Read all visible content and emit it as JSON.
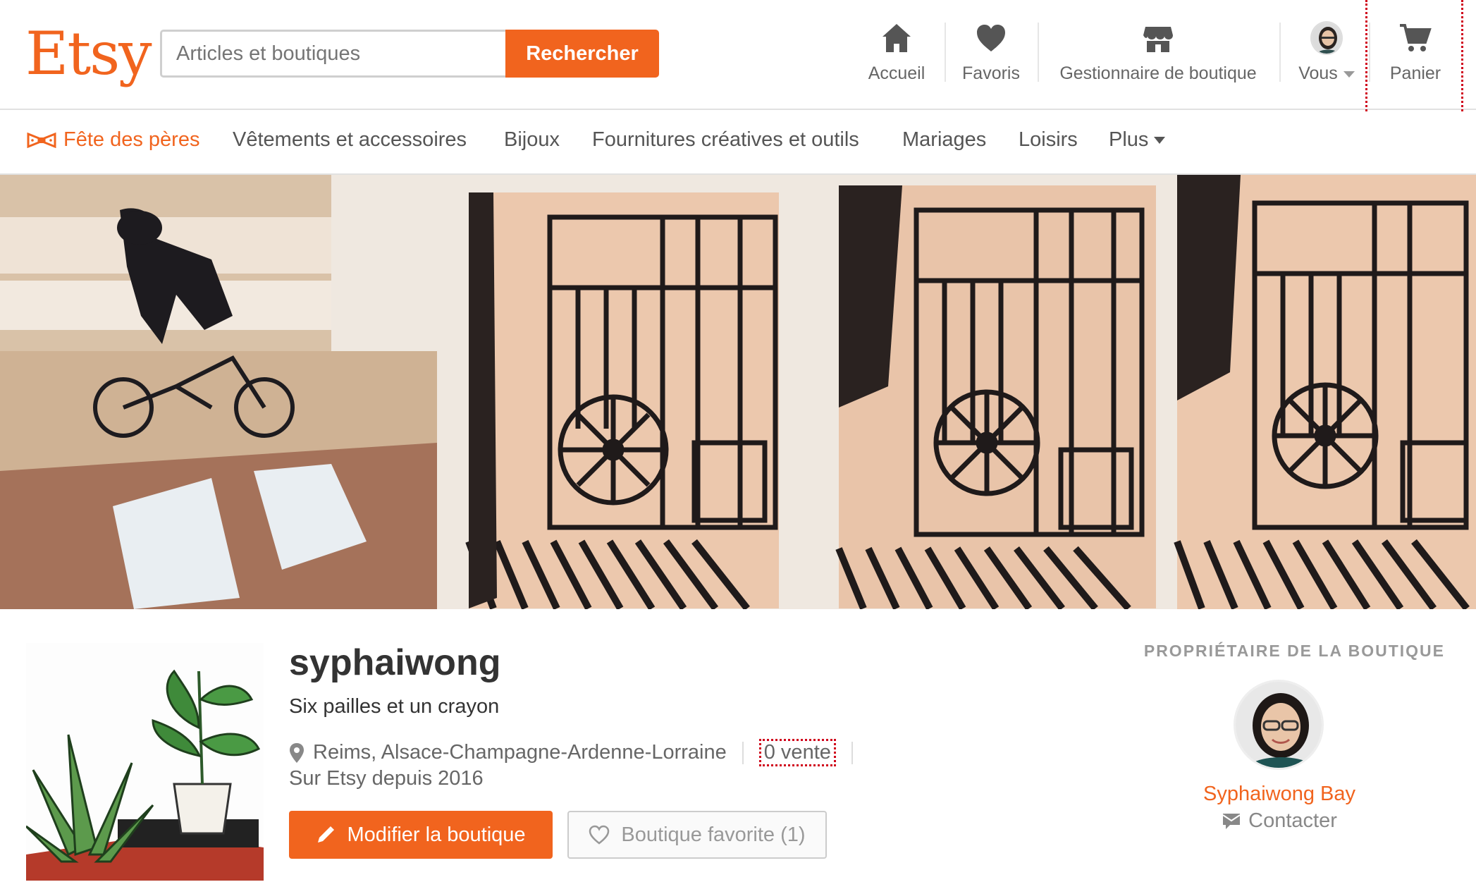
{
  "header": {
    "logo": "Etsy",
    "search": {
      "placeholder": "Articles et boutiques",
      "value": ""
    },
    "search_button": "Rechercher",
    "nav": {
      "home": {
        "label": "Accueil",
        "icon": "home-icon"
      },
      "favorites": {
        "label": "Favoris",
        "icon": "heart-icon"
      },
      "shop_manager": {
        "label": "Gestionnaire de boutique",
        "icon": "store-icon"
      },
      "you": {
        "label": "Vous",
        "icon": "avatar"
      },
      "cart": {
        "label": "Panier",
        "icon": "cart-icon"
      }
    }
  },
  "categories": {
    "highlight": {
      "label": "Fête des pères",
      "icon": "bowtie-icon"
    },
    "items": [
      "Vêtements et accessoires",
      "Bijoux",
      "Fournitures créatives et outils",
      "Mariages",
      "Loisirs"
    ],
    "more": "Plus"
  },
  "shop": {
    "name": "syphaiwong",
    "tagline": "Six pailles et un crayon",
    "location": "Reims, Alsace-Champagne-Ardenne-Lorraine",
    "sales": "0 vente",
    "since": "Sur Etsy depuis 2016",
    "edit_button": "Modifier la boutique",
    "favorite_button": "Boutique favorite (1)"
  },
  "owner": {
    "heading": "PROPRIÉTAIRE DE LA BOUTIQUE",
    "name": "Syphaiwong Bay",
    "contact": "Contacter"
  },
  "colors": {
    "brand": "#f1641e",
    "highlight_outline": "#d0021b",
    "text_muted": "#666666"
  }
}
